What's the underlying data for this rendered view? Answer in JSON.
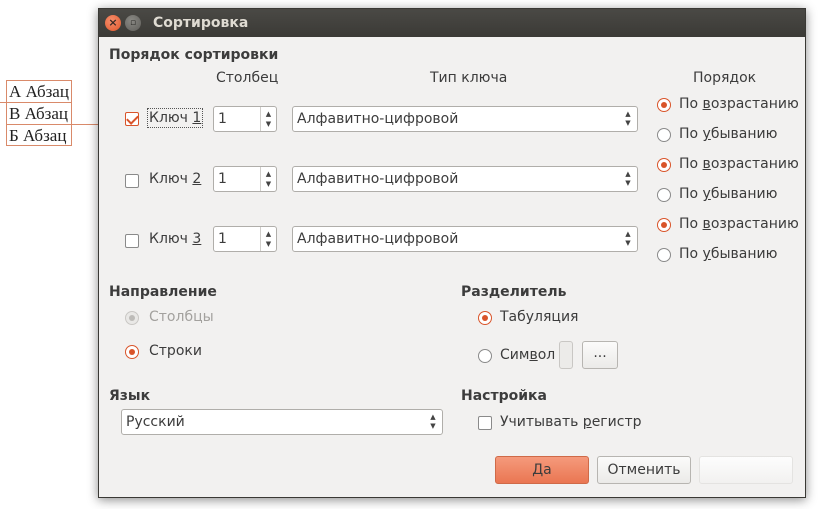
{
  "document": {
    "paragraphs": [
      "А Абзац",
      "В Абзац",
      "Б Абзац"
    ]
  },
  "dialog": {
    "title": "Сортировка",
    "close_glyph": "×",
    "minimize_glyph": "▫",
    "sort_order": {
      "heading": "Порядок сортировки",
      "column_header": "Столбец",
      "key_type_header": "Тип ключа",
      "order_header": "Порядок",
      "keys": [
        {
          "label_main": "Ключ ",
          "label_mnemonic": "1",
          "checked": true,
          "column": "1",
          "type": "Алфавитно-цифровой"
        },
        {
          "label_main": "Ключ ",
          "label_mnemonic": "2",
          "checked": false,
          "column": "1",
          "type": "Алфавитно-цифровой"
        },
        {
          "label_main": "Ключ ",
          "label_mnemonic": "3",
          "checked": false,
          "column": "1",
          "type": "Алфавитно-цифровой"
        }
      ],
      "orders": [
        {
          "asc_pre": "По ",
          "asc_mn": "в",
          "asc_post": "озрастанию",
          "desc_pre": "По ",
          "desc_mn": "у",
          "desc_post": "быванию",
          "selected": "asc"
        },
        {
          "asc_pre": "По ",
          "asc_mn": "в",
          "asc_post": "озрастанию",
          "desc_pre": "По ",
          "desc_mn": "у",
          "desc_post": "быванию",
          "selected": "asc"
        },
        {
          "asc_pre": "По ",
          "asc_mn": "в",
          "asc_post": "озрастанию",
          "desc_pre": "По ",
          "desc_mn": "у",
          "desc_post": "быванию",
          "selected": "asc"
        }
      ]
    },
    "direction": {
      "heading": "Направление",
      "columns_label": "Столбцы",
      "rows_label": "Строки",
      "selected": "rows"
    },
    "separator": {
      "heading": "Разделитель",
      "tab_label": "Табуляция",
      "symbol_pre": "Сим",
      "symbol_mn": "в",
      "symbol_post": "ол",
      "selected": "tab",
      "browse_label": "..."
    },
    "language": {
      "heading": "Язык",
      "value": "Русский"
    },
    "options": {
      "heading": "Настройка",
      "case_pre": "Учитывать ",
      "case_mn": "р",
      "case_post": "егистр",
      "case_checked": false
    },
    "buttons": {
      "ok": "Да",
      "cancel": "Отменить"
    }
  },
  "spin_up": "▲",
  "spin_down": "▼",
  "accent_color": "#e9663d"
}
